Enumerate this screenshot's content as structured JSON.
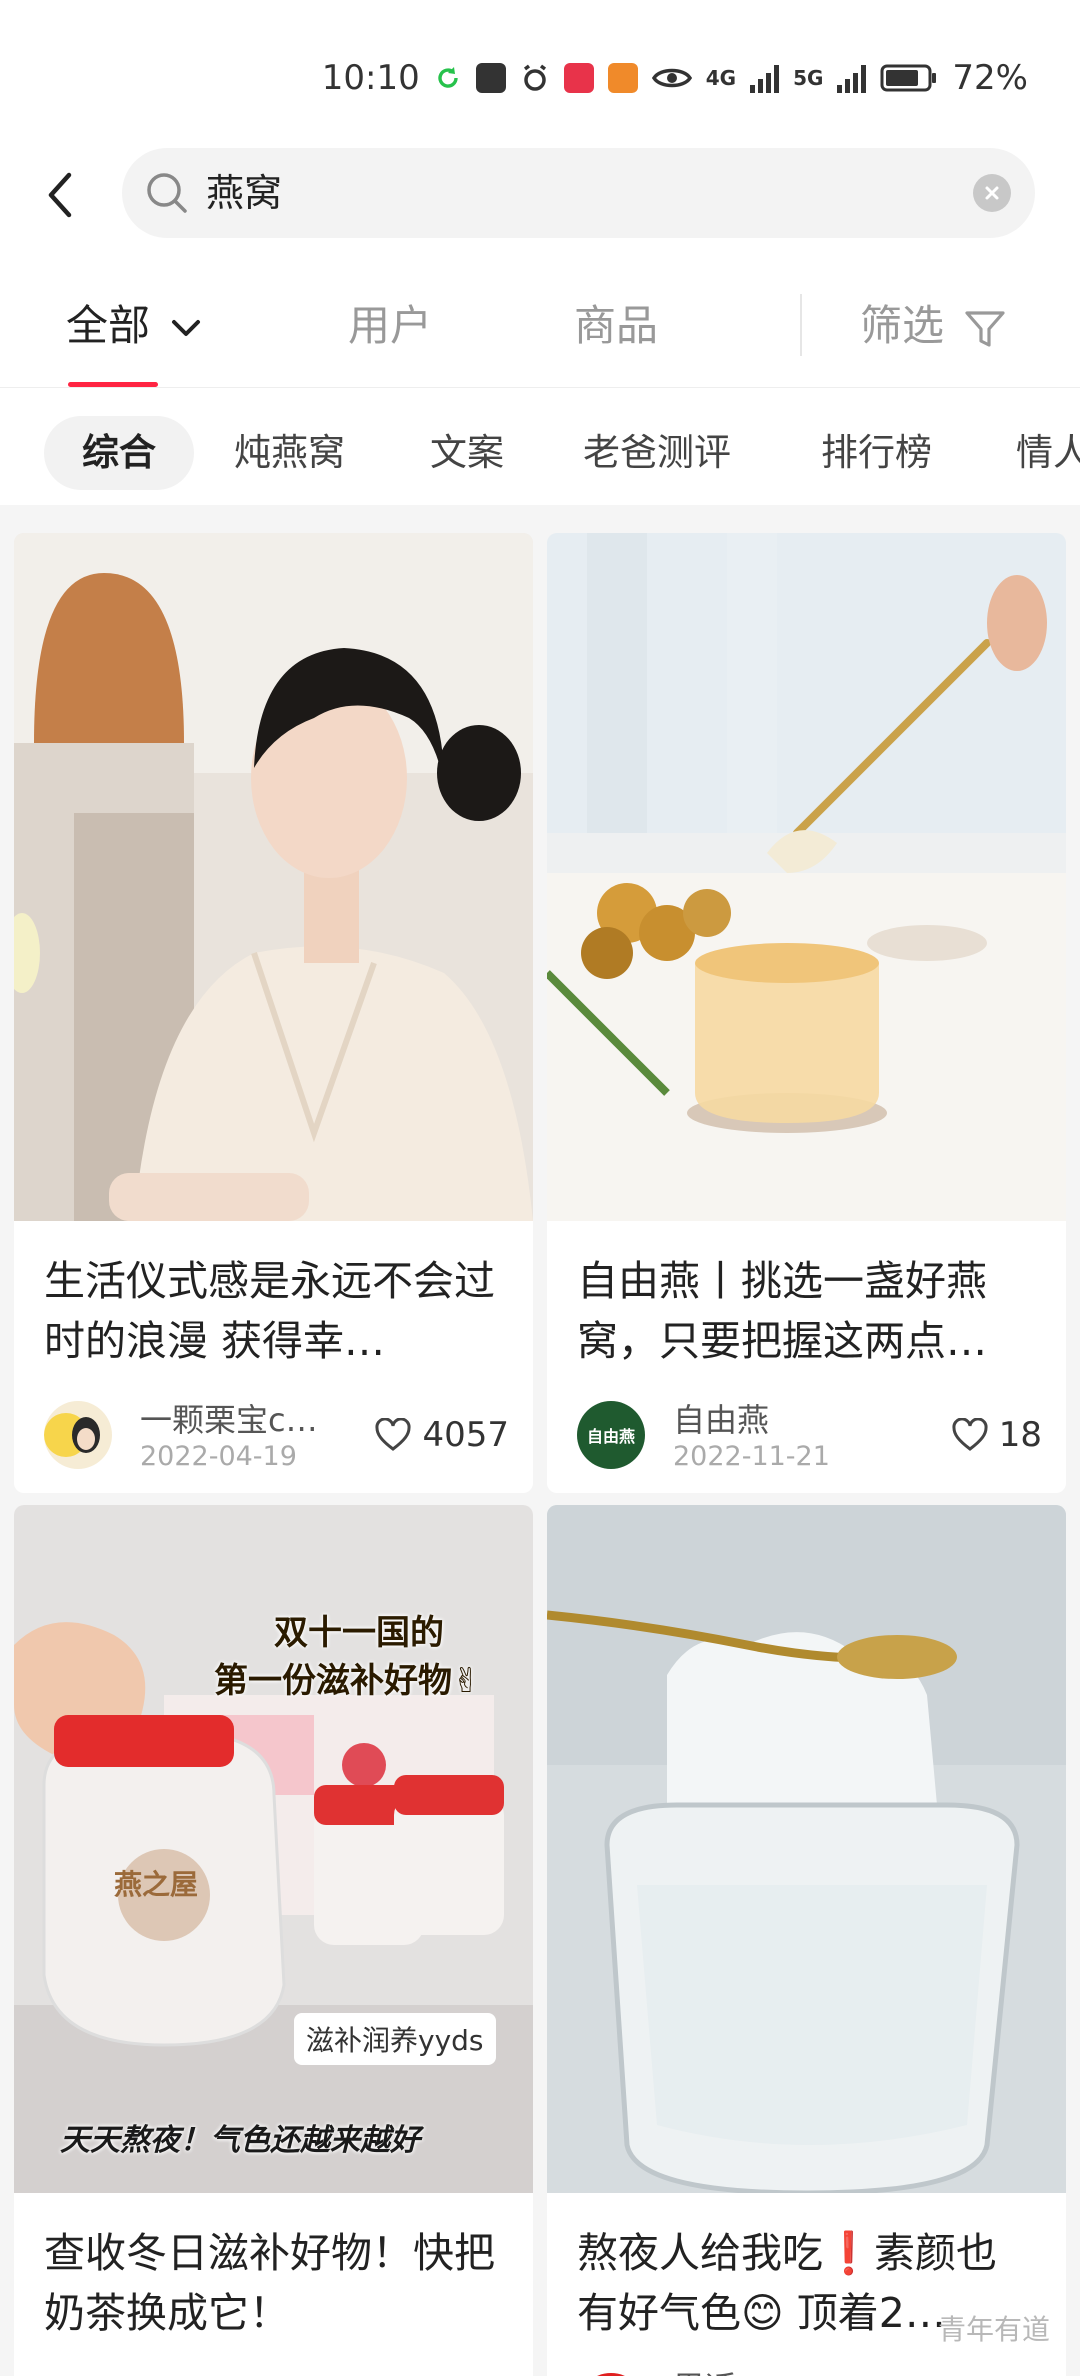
{
  "status_bar": {
    "time": "10:10",
    "network_1": "4G",
    "network_2": "5G",
    "battery": "72%"
  },
  "search": {
    "query": "燕窝",
    "icons": [
      "back-arrow-icon",
      "search-icon",
      "clear-icon"
    ]
  },
  "main_tabs": {
    "all": "全部",
    "users": "用户",
    "products": "商品",
    "filter": "筛选"
  },
  "sub_tabs": [
    "综合",
    "炖燕窝",
    "文案",
    "老爸测评",
    "排行榜",
    "情人"
  ],
  "cards": [
    {
      "title": "生活仪式感是永远不会过时的浪漫 获得幸…",
      "author": "一颗栗宝c…",
      "date": "2022-04-19",
      "likes": "4057"
    },
    {
      "title": "自由燕丨挑选一盏好燕窝，只要把握这两点…",
      "author": "自由燕",
      "avatar_text": "自由燕",
      "date": "2022-11-21",
      "likes": "18"
    },
    {
      "title": "查收冬日滋补好物！快把奶茶换成它！",
      "sticker_line_1": "双十一国的",
      "sticker_line_2": "第一份滋补好物✌",
      "tag": "滋补润养yyds",
      "caption": "天天熬夜！气色还越来越好",
      "jar_label": "燕之屋"
    },
    {
      "title": "熬夜人给我吃❗素颜也有好气色😊 顶着2…",
      "author": "思适"
    }
  ],
  "watermark": "青年有道",
  "colors": {
    "accent": "#ff2442",
    "background": "#f5f5f5"
  }
}
